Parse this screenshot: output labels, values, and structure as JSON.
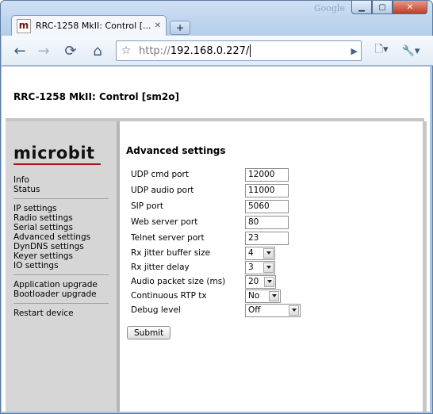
{
  "browser": {
    "watermark": "Google",
    "tab_title": "RRC-1258 MkII: Control [...",
    "tab_favicon_letter": "m",
    "url_scheme": "http://",
    "url_host": "192.168.0.227/",
    "controls": {
      "back": "←",
      "forward": "→",
      "reload": "⟳",
      "home": "⌂",
      "bookmark": "☆",
      "go": "▶",
      "page_menu": "🗋▾",
      "tools_menu": "🔧▾",
      "minimize": "▁",
      "maximize": "▢",
      "close": "✕",
      "new_tab": "+",
      "tab_close": "✕"
    }
  },
  "page": {
    "device_title": "RRC-1258 MkII: Control [sm2o]",
    "logo_text": "microbit",
    "brand_color": "#b0101c",
    "menu": {
      "group1": [
        "Info",
        "Status"
      ],
      "group2": [
        "IP settings",
        "Radio settings",
        "Serial settings",
        "Advanced settings",
        "DynDNS settings",
        "Keyer settings",
        "IO settings"
      ],
      "group3": [
        "Application upgrade",
        "Bootloader upgrade"
      ],
      "group4": [
        "Restart device"
      ]
    },
    "section_title": "Advanced settings",
    "fields": {
      "udp_cmd_port": {
        "label": "UDP cmd port",
        "value": "12000"
      },
      "udp_audio_port": {
        "label": "UDP audio port",
        "value": "11000"
      },
      "sip_port": {
        "label": "SIP port",
        "value": "5060"
      },
      "web_server_port": {
        "label": "Web server port",
        "value": "80"
      },
      "telnet_server_port": {
        "label": "Telnet server port",
        "value": "23"
      },
      "rx_jitter_buffer_size": {
        "label": "Rx jitter buffer size",
        "value": "4"
      },
      "rx_jitter_delay": {
        "label": "Rx jitter delay",
        "value": "3"
      },
      "audio_packet_size": {
        "label": "Audio packet size (ms)",
        "value": "20"
      },
      "continuous_rtp_tx": {
        "label": "Continuous RTP tx",
        "value": "No"
      },
      "debug_level": {
        "label": "Debug level",
        "value": "Off"
      }
    },
    "submit_label": "Submit"
  }
}
